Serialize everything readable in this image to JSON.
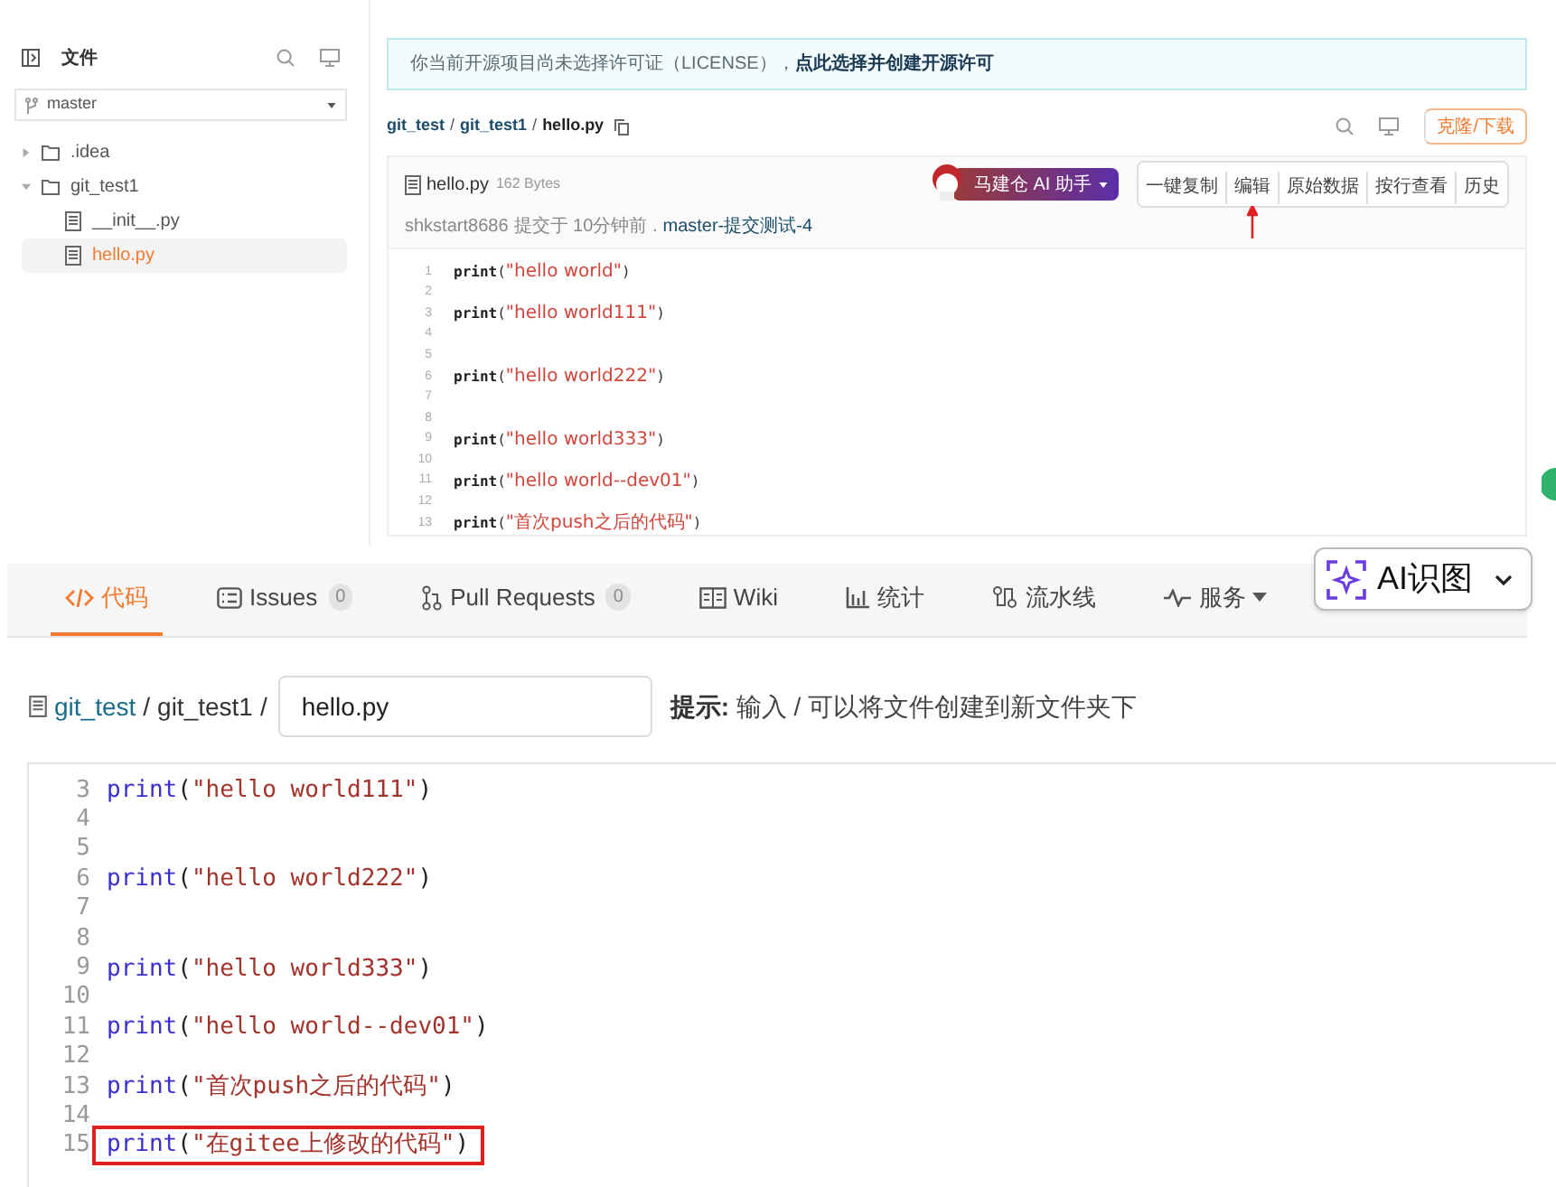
{
  "sidebar": {
    "title": "文件",
    "branch": "master",
    "tree": [
      {
        "name": ".idea",
        "kind": "folder",
        "expanded": false,
        "selected": false
      },
      {
        "name": "git_test1",
        "kind": "folder",
        "expanded": true,
        "selected": false,
        "children": [
          {
            "name": "__init__.py",
            "kind": "file",
            "selected": false
          },
          {
            "name": "hello.py",
            "kind": "file",
            "selected": true
          }
        ]
      }
    ]
  },
  "notice": {
    "text": "你当前开源项目尚未选择许可证（LICENSE），",
    "link": "点此选择并创建开源许可"
  },
  "breadcrumb": [
    {
      "label": "git_test",
      "separator": "/"
    },
    {
      "label": "git_test1",
      "separator": "/"
    },
    {
      "label": "hello.py"
    }
  ],
  "clone_button": "克隆/下载",
  "file_header": {
    "name": "hello.py",
    "size": "162 Bytes",
    "ai_button": "马建仓 AI 助手",
    "actions": [
      {
        "label": "一键复制",
        "annotated": false
      },
      {
        "label": "编辑",
        "annotated": true
      },
      {
        "label": "原始数据",
        "annotated": false
      },
      {
        "label": "按行查看",
        "annotated": false
      },
      {
        "label": "历史",
        "annotated": false
      }
    ],
    "commit": {
      "author": "shkstart8686",
      "text": "提交于 10分钟前 .",
      "message": "master-提交测试-4"
    }
  },
  "code_view": [
    {
      "number": "1",
      "code": "print(\"hello world\")"
    },
    {
      "number": "2"
    },
    {
      "number": "3",
      "code": "print(\"hello world111\")"
    },
    {
      "number": "4"
    },
    {
      "number": "5"
    },
    {
      "number": "6",
      "code": "print(\"hello world222\")"
    },
    {
      "number": "7"
    },
    {
      "number": "8"
    },
    {
      "number": "9",
      "code": "print(\"hello world333\")"
    },
    {
      "number": "10"
    },
    {
      "number": "11",
      "code": "print(\"hello world--dev01\")"
    },
    {
      "number": "12"
    },
    {
      "number": "13",
      "code": "print(\"首次push之后的代码\")"
    }
  ],
  "tabs": [
    {
      "label": "代码",
      "kind": "code",
      "selected": true
    },
    {
      "label": "Issues",
      "kind": "issues",
      "count": "0",
      "selected": false
    },
    {
      "label": "Pull Requests",
      "kind": "pr",
      "count": "0",
      "selected": false
    },
    {
      "label": "Wiki",
      "kind": "wiki",
      "selected": false
    },
    {
      "label": "统计",
      "kind": "stats",
      "selected": false
    },
    {
      "label": "流水线",
      "kind": "pipeline",
      "selected": false
    },
    {
      "label": "服务",
      "kind": "service",
      "selected": false
    }
  ],
  "ai_overlay": {
    "label": "AI识图"
  },
  "editor": {
    "path": [
      {
        "label": "git_test",
        "separator": "/"
      },
      {
        "label": "git_test1",
        "separator": "/"
      }
    ],
    "filename": "hello.py",
    "hint_label": "提示:",
    "hint": "输入 / 可以将文件创建到新文件夹下",
    "lines": [
      {
        "number": "3",
        "code": "print(\"hello world111\")",
        "annotated": false
      },
      {
        "number": "4"
      },
      {
        "number": "5"
      },
      {
        "number": "6",
        "code": "print(\"hello world222\")",
        "annotated": false
      },
      {
        "number": "7"
      },
      {
        "number": "8"
      },
      {
        "number": "9",
        "code": "print(\"hello world333\")",
        "annotated": false
      },
      {
        "number": "10"
      },
      {
        "number": "11",
        "code": "print(\"hello world--dev01\")",
        "annotated": false
      },
      {
        "number": "12"
      },
      {
        "number": "13",
        "code": "print(\"首次push之后的代码\")",
        "annotated": false
      },
      {
        "number": "14"
      },
      {
        "number": "15",
        "code": "print(\"在gitee上修改的代码\")",
        "annotated": true
      }
    ]
  }
}
